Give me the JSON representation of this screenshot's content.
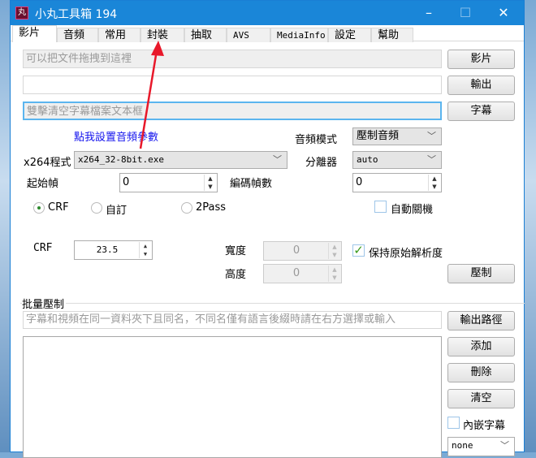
{
  "window": {
    "title": "小丸工具箱 194",
    "icon_text": "丸",
    "minimize": "–",
    "maximize": "☐",
    "close": "✕"
  },
  "tabs": [
    "影片",
    "音頻",
    "常用",
    "封裝",
    "抽取",
    "AVS",
    "MediaInfo",
    "設定",
    "幫助"
  ],
  "video": {
    "input_placeholder": "可以把文件拖拽到這裡",
    "video_button": "影片",
    "output_value": "",
    "output_button": "輸出",
    "subtitle_placeholder": "雙擊清空字幕檔案文本框",
    "subtitle_button": "字幕",
    "audio_link": "點我設置音頻參數",
    "audio_mode_label": "音頻模式",
    "audio_mode_value": "壓制音頻",
    "x264_label": "x264程式",
    "x264_value": "x264_32-8bit.exe",
    "splitter_label": "分離器",
    "splitter_value": "auto",
    "start_frame_label": "起始幀",
    "start_frame_value": "0",
    "encode_frames_label": "編碼幀數",
    "encode_frames_value": "0",
    "modes": [
      "CRF",
      "自訂",
      "2Pass"
    ],
    "selected_mode": "CRF",
    "auto_shutdown_label": "自動關機",
    "auto_shutdown_checked": false,
    "crf_label": "CRF",
    "crf_value": "23.5",
    "width_label": "寬度",
    "width_value": "0",
    "height_label": "高度",
    "height_value": "0",
    "keep_resolution_label": "保持原始解析度",
    "keep_resolution_checked": true,
    "encode_button": "壓制"
  },
  "batch": {
    "group_label": "批量壓制",
    "suffix_placeholder": "字幕和視頻在同一資料夾下且同名，不同名僅有語言後綴時請在右方選擇或輸入",
    "output_path_button": "輸出路徑",
    "add_button": "添加",
    "delete_button": "刪除",
    "clear_button": "清空",
    "embed_sub_label": "內嵌字幕",
    "embed_sub_checked": false,
    "sub_select_value": "none"
  },
  "colors": {
    "titlebar": "#1a86d8",
    "link": "#1515ee",
    "arrow": "#e8182a"
  }
}
